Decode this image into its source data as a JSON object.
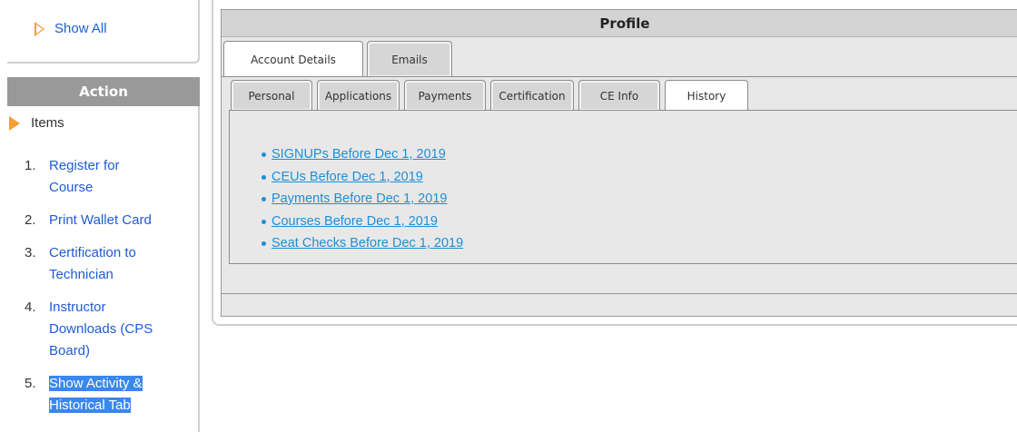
{
  "sidebar": {
    "show_all_label": "Show All",
    "action_header": "Action",
    "items_label": "Items",
    "actions": [
      {
        "num": "1.",
        "label": "Register for Course",
        "lines": [
          "Register for",
          "Course"
        ],
        "selected": false
      },
      {
        "num": "2.",
        "label": "Print Wallet Card",
        "lines": [
          "Print Wallet Card"
        ],
        "selected": false
      },
      {
        "num": "3.",
        "label": "Certification to Technician",
        "lines": [
          "Certification to",
          "Technician"
        ],
        "selected": false
      },
      {
        "num": "4.",
        "label": "Instructor Downloads (CPS Board)",
        "lines": [
          "Instructor",
          "Downloads (CPS",
          "Board)"
        ],
        "selected": false
      },
      {
        "num": "5.",
        "label": "Show Activity & Historical Tab",
        "lines": [
          "Show Activity &",
          "Historical Tab"
        ],
        "selected": true
      }
    ]
  },
  "profile": {
    "title": "Profile",
    "outer_tabs": [
      {
        "label": "Account Details",
        "active": true
      },
      {
        "label": "Emails",
        "active": false
      }
    ],
    "inner_tabs": [
      {
        "label": "Personal",
        "active": false
      },
      {
        "label": "Applications",
        "active": false
      },
      {
        "label": "Payments",
        "active": false
      },
      {
        "label": "Certification",
        "active": false
      },
      {
        "label": "CE Info",
        "active": false
      },
      {
        "label": "History",
        "active": true
      }
    ],
    "history_links": [
      "SIGNUPs Before Dec 1, 2019",
      "CEUs Before Dec 1, 2019",
      "Payments Before Dec 1, 2019",
      "Courses Before Dec 1, 2019",
      "Seat Checks Before Dec 1, 2019"
    ]
  },
  "colors": {
    "link": "#1f5bd6",
    "history_link": "#1e8fd6",
    "accent_triangle": "#f5a033",
    "selection": "#3a87f0",
    "action_header_bg": "#999999"
  },
  "icons": {
    "show_all": "triangle-outline-icon",
    "items": "triangle-solid-icon"
  }
}
